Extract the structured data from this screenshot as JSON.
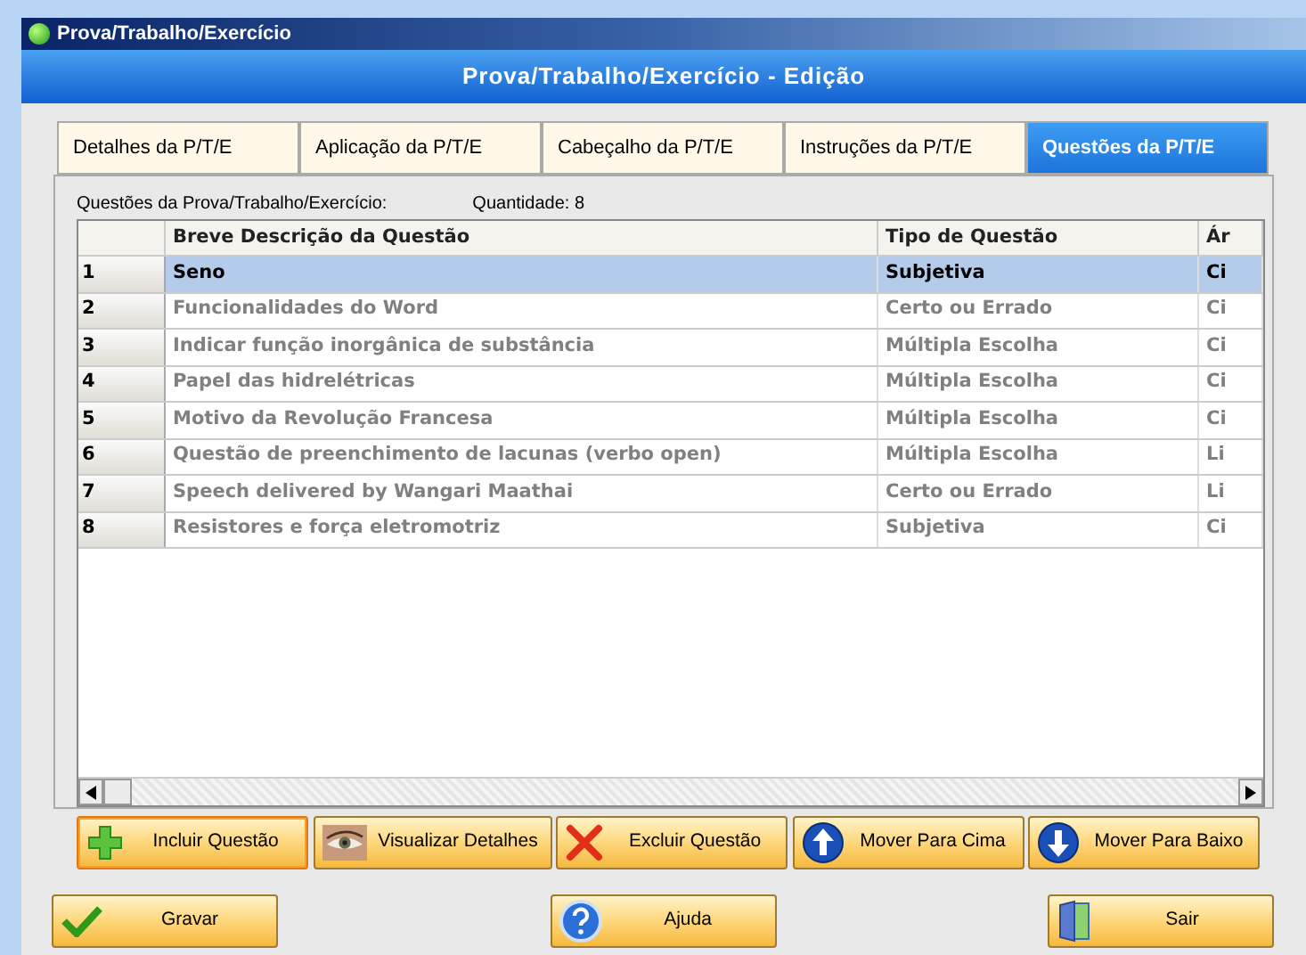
{
  "window": {
    "title": "Prova/Trabalho/Exercício"
  },
  "header": {
    "title": "Prova/Trabalho/Exercício - Edição"
  },
  "tabs": [
    {
      "label": "Detalhes da P/T/E",
      "selected": false
    },
    {
      "label": "Aplicação da P/T/E",
      "selected": false
    },
    {
      "label": "Cabeçalho da P/T/E",
      "selected": false
    },
    {
      "label": "Instruções da P/T/E",
      "selected": false
    },
    {
      "label": "Questões da P/T/E",
      "selected": true
    }
  ],
  "panel": {
    "label": "Questões da Prova/Trabalho/Exercício:",
    "count": "Quantidade: 8"
  },
  "table": {
    "columns": [
      "Breve Descrição da Questão",
      "Tipo de Questão",
      "Ár"
    ],
    "rows": [
      {
        "number": "1",
        "cells": [
          "Seno",
          "Subjetiva",
          "Ci"
        ],
        "selected": true
      },
      {
        "number": "2",
        "cells": [
          "Funcionalidades do Word",
          "Certo ou Errado",
          "Ci"
        ],
        "selected": false
      },
      {
        "number": "3",
        "cells": [
          "Indicar função inorgânica de substância",
          "Múltipla Escolha",
          "Ci"
        ],
        "selected": false
      },
      {
        "number": "4",
        "cells": [
          "Papel das hidrelétricas",
          "Múltipla Escolha",
          "Ci"
        ],
        "selected": false
      },
      {
        "number": "5",
        "cells": [
          "Motivo da Revolução Francesa",
          "Múltipla Escolha",
          "Ci"
        ],
        "selected": false
      },
      {
        "number": "6",
        "cells": [
          "Questão de preenchimento de lacunas (verbo open)",
          "Múltipla Escolha",
          "Li"
        ],
        "selected": false
      },
      {
        "number": "7",
        "cells": [
          "Speech delivered by Wangari Maathai",
          "Certo ou Errado",
          "Li"
        ],
        "selected": false
      },
      {
        "number": "8",
        "cells": [
          "Resistores e força eletromotriz",
          "Subjetiva",
          "Ci"
        ],
        "selected": false
      }
    ]
  },
  "actions": [
    {
      "kind": "plus",
      "label": "Incluir Questão",
      "focused": true
    },
    {
      "kind": "eye",
      "label": "Visualizar Detalhes",
      "focused": false
    },
    {
      "kind": "cross",
      "label": "Excluir Questão",
      "focused": false
    },
    {
      "kind": "up",
      "label": "Mover Para Cima",
      "focused": false
    },
    {
      "kind": "down",
      "label": "Mover Para Baixo",
      "focused": false
    }
  ],
  "footer": [
    {
      "kind": "check",
      "label": "Gravar"
    },
    {
      "kind": "help",
      "label": "Ajuda"
    },
    {
      "kind": "door",
      "label": "Sair"
    }
  ]
}
